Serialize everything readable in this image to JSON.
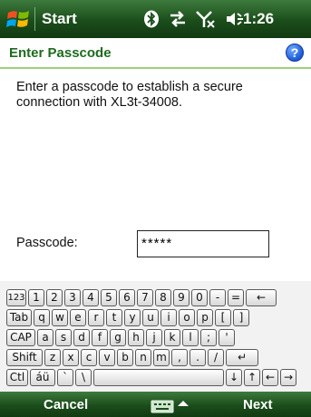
{
  "taskbar": {
    "start_label": "Start",
    "clock": "1:26",
    "icons": [
      "windows-flag-icon",
      "bluetooth-icon",
      "connectivity-icon",
      "no-signal-icon",
      "volume-icon"
    ]
  },
  "dialog": {
    "title": "Enter Passcode",
    "help_icon": "?",
    "instruction": "Enter a passcode to establish a secure connection with XL3t-34008."
  },
  "passcode": {
    "label": "Passcode:",
    "value": "*****"
  },
  "keyboard": {
    "rows": [
      [
        "123",
        "1",
        "2",
        "3",
        "4",
        "5",
        "6",
        "7",
        "8",
        "9",
        "0",
        "-",
        "=",
        "←"
      ],
      [
        "Tab",
        "q",
        "w",
        "e",
        "r",
        "t",
        "y",
        "u",
        "i",
        "o",
        "p",
        "[",
        "]"
      ],
      [
        "CAP",
        "a",
        "s",
        "d",
        "f",
        "g",
        "h",
        "j",
        "k",
        "l",
        ";",
        "'"
      ],
      [
        "Shift",
        "z",
        "x",
        "c",
        "v",
        "b",
        "n",
        "m",
        ",",
        ".",
        "/",
        "↵"
      ],
      [
        "Ctl",
        "áü",
        "`",
        "\\",
        " ",
        "↓",
        "↑",
        "←",
        "→"
      ]
    ]
  },
  "softkeys": {
    "left": "Cancel",
    "right": "Next"
  },
  "colors": {
    "bar_green": "#1b4d1b",
    "title_green": "#1e6b1e",
    "separator_green": "#9ccf7e"
  }
}
